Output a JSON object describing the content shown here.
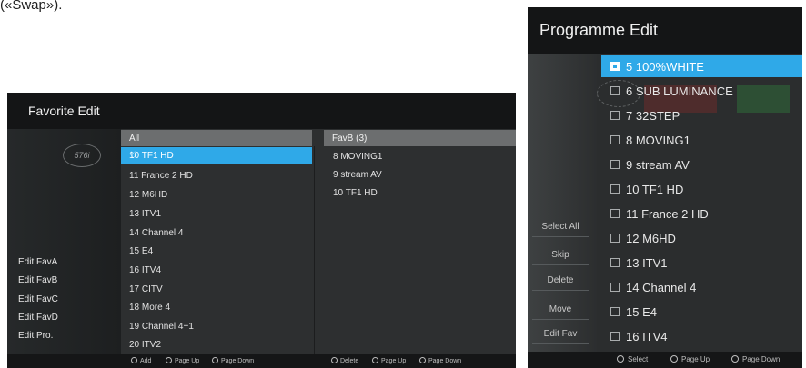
{
  "caption": "(«Swap»).",
  "favorite_edit": {
    "title": "Favorite Edit",
    "clock_label": "576i",
    "edit_items": [
      "Edit FavA",
      "Edit FavB",
      "Edit FavC",
      "Edit FavD",
      "Edit Pro."
    ],
    "all_header": "All",
    "channels": [
      "10 TF1 HD",
      "11 France 2 HD",
      "12 M6HD",
      "13 ITV1",
      "14 Channel 4",
      "15 E4",
      "16 ITV4",
      "17 CITV",
      "18 More 4",
      "19 Channel 4+1",
      "20 ITV2"
    ],
    "selected_channel": "10 TF1 HD",
    "heart_icon": "♡",
    "fav_header": "FavB (3)",
    "fav_channels": [
      "8 MOVING1",
      "9 stream AV",
      "10 TF1 HD"
    ],
    "footer": {
      "add": "Add",
      "page_up": "Page Up",
      "page_down": "Page Down",
      "delete": "Delete",
      "page_up_2": "Page Up",
      "page_down_2": "Page Down"
    }
  },
  "programme_edit": {
    "title": "Programme Edit",
    "side_buttons": [
      "Select All",
      "Skip",
      "Delete",
      "Move",
      "Edit Fav"
    ],
    "programmes": [
      "5 100%WHITE",
      "6 SUB LUMINANCE",
      "7 32STEP",
      "8 MOVING1",
      "9 stream AV",
      "10 TF1 HD",
      "11 France 2 HD",
      "12 M6HD",
      "13 ITV1",
      "14 Channel 4",
      "15 E4",
      "16 ITV4"
    ],
    "selected_programme": "5 100%WHITE",
    "footer": {
      "select": "Select",
      "page_up": "Page Up",
      "page_down": "Page Down"
    }
  },
  "colors": {
    "highlight": "#2fa9e8",
    "title_bar": "#141516",
    "panel": "#2d2f30"
  }
}
